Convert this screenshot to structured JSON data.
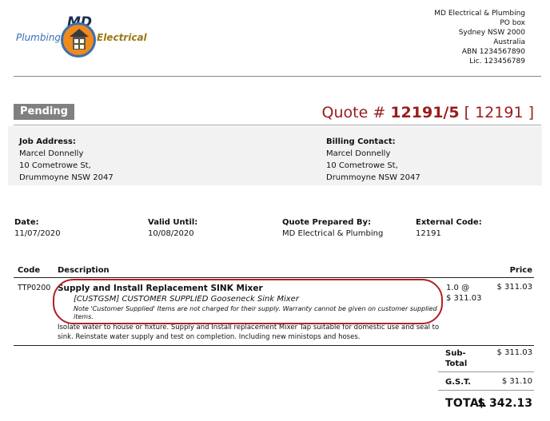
{
  "logo": {
    "md": "MD",
    "plumbing": "Plumbing",
    "electrical": "Electrical"
  },
  "company": {
    "name": "MD Electrical & Plumbing",
    "address_line1": "PO box",
    "address_line2": "Sydney NSW 2000",
    "country": "Australia",
    "abn": "ABN 1234567890",
    "licence": "Lic. 123456789"
  },
  "status": "Pending",
  "quote": {
    "prefix": "Quote #",
    "number": "12191/5",
    "ref": "[ 12191 ]"
  },
  "job_address": {
    "label": "Job Address:",
    "name": "Marcel Donnelly",
    "street": "10 Cometrowe St,",
    "suburb": "Drummoyne NSW 2047"
  },
  "billing_contact": {
    "label": "Billing Contact:",
    "name": "Marcel Donnelly",
    "street": "10 Cometrowe St,",
    "suburb": "Drummoyne NSW 2047"
  },
  "details": {
    "date_label": "Date:",
    "date_value": "11/07/2020",
    "valid_label": "Valid Until:",
    "valid_value": "10/08/2020",
    "prepared_label": "Quote Prepared By:",
    "prepared_value": "MD Electrical & Plumbing",
    "external_label": "External Code:",
    "external_value": "12191"
  },
  "table": {
    "col_code": "Code",
    "col_description": "Description",
    "col_price": "Price"
  },
  "item": {
    "code": "TTP0200",
    "title": "Supply and Install Replacement SINK Mixer",
    "sub": "[CUSTGSM] CUSTOMER SUPPLIED Gooseneck Sink Mixer",
    "note": "Note 'Customer Supplied' Items are not charged for their supply. Warranty cannot be given on customer supplied items.",
    "description": "Isolate water to house or fixture. Supply and Install replacement Mixer Tap suitable for domestic use and seal to sink. Reinstate water supply and test on completion. Including new ministops and hoses.",
    "qty": "1.0 @",
    "unit_price": "$ 311.03",
    "price": "$ 311.03"
  },
  "totals": {
    "subtotal_label": "Sub-\nTotal",
    "subtotal_label_line1": "Sub-",
    "subtotal_label_line2": "Total",
    "subtotal_value": "$ 311.03",
    "gst_label": "G.S.T.",
    "gst_value": "$ 31.10",
    "total_label": "TOTAL",
    "total_value": "$ 342.13"
  },
  "colors": {
    "accent": "#9a1b1b",
    "highlight_ring": "#b22222",
    "pending_badge": "#808080"
  }
}
